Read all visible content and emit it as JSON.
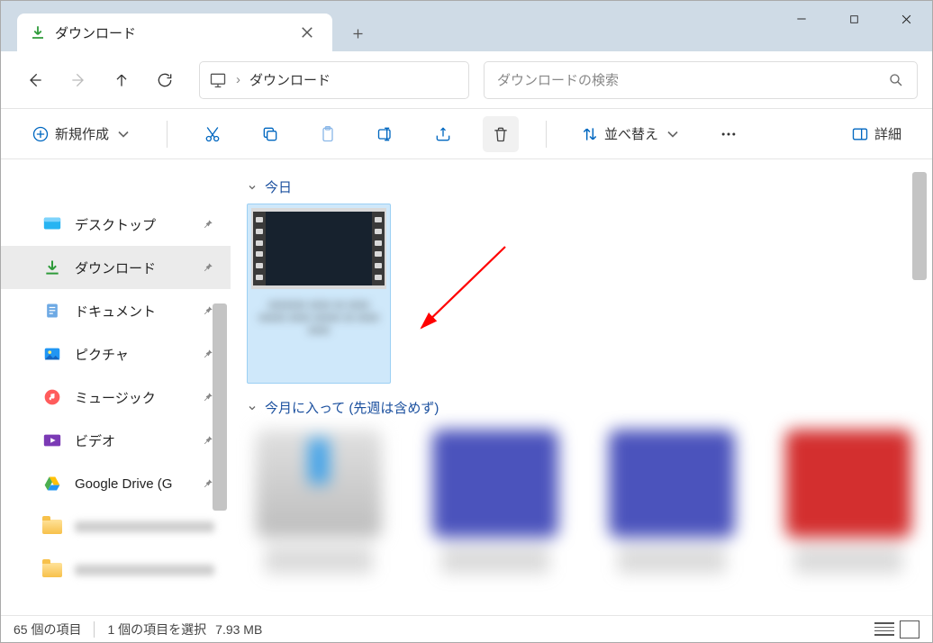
{
  "tab": {
    "title": "ダウンロード"
  },
  "path": {
    "current": "ダウンロード"
  },
  "search": {
    "placeholder": "ダウンロードの検索"
  },
  "toolbar": {
    "new": "新規作成",
    "sort": "並べ替え",
    "details": "詳細"
  },
  "sidebar": {
    "items": [
      {
        "label": "デスクトップ"
      },
      {
        "label": "ダウンロード"
      },
      {
        "label": "ドキュメント"
      },
      {
        "label": "ピクチャ"
      },
      {
        "label": "ミュージック"
      },
      {
        "label": "ビデオ"
      },
      {
        "label": "Google Drive (G"
      }
    ]
  },
  "groups": {
    "today": "今日",
    "month": "今月に入って (先週は含めず)"
  },
  "status": {
    "count": "65 個の項目",
    "selected": "1 個の項目を選択",
    "size": "7.93 MB"
  }
}
